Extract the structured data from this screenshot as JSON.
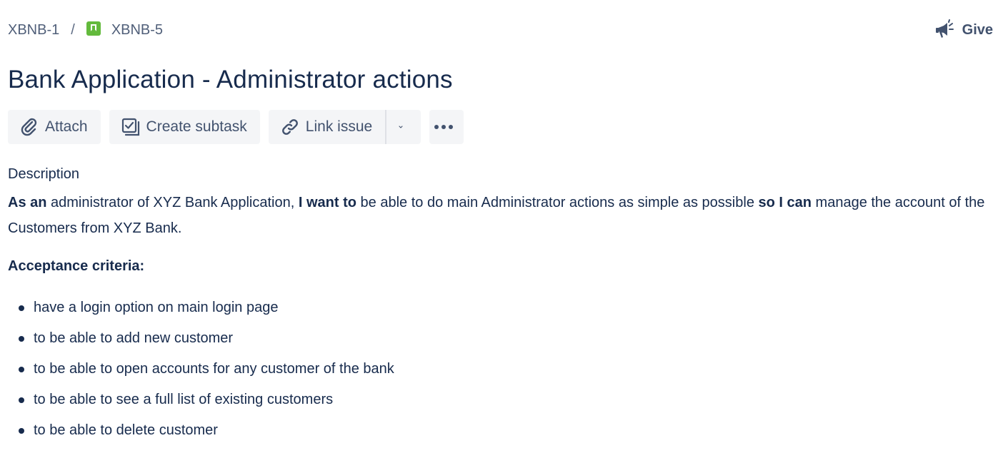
{
  "breadcrumb": {
    "parent": "XBNB-1",
    "separator": "/",
    "current": "XBNB-5",
    "current_icon": "story-icon"
  },
  "feedback": {
    "label": "Give",
    "icon": "megaphone-icon"
  },
  "issue": {
    "title": "Bank Application - Administrator actions"
  },
  "toolbar": {
    "attach_label": "Attach",
    "create_subtask_label": "Create subtask",
    "link_issue_label": "Link issue",
    "attach_icon": "paperclip-icon",
    "subtask_icon": "subtask-icon",
    "link_icon": "link-icon",
    "dropdown_icon": "chevron-down-icon",
    "more_icon": "more-icon"
  },
  "description": {
    "label": "Description",
    "story": {
      "bold_1": "As an",
      "text_1": " administrator of XYZ Bank Application, ",
      "bold_2": "I want to",
      "text_2": " be able to do main Administrator actions as simple as possible ",
      "bold_3": "so I can",
      "text_3": " manage the account of the Customers from XYZ Bank."
    },
    "acceptance_heading": "Acceptance criteria:",
    "criteria": [
      "have a login option on main login page",
      "to be able to add new customer",
      "to be able to open accounts for any customer of the bank",
      "to be able to see a full list of existing customers",
      "to be able to delete customer"
    ]
  },
  "colors": {
    "text": "#172b4d",
    "subtle_text": "#42526e",
    "button_bg": "#f4f5f7",
    "story_green": "#63ba3c"
  }
}
